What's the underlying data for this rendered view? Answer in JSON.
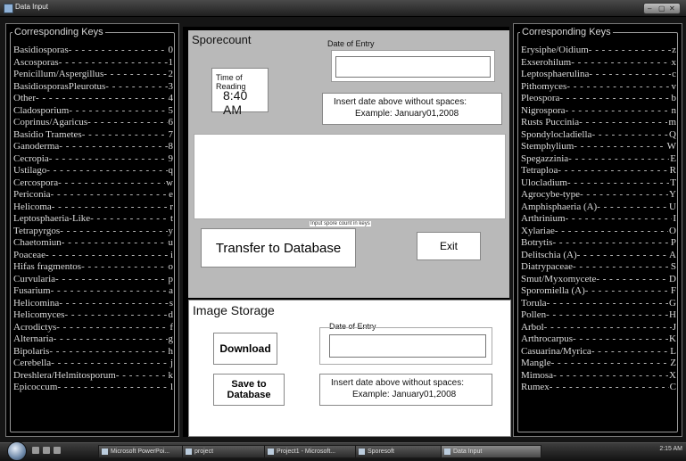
{
  "window": {
    "title": "Data Input",
    "controls": [
      "–",
      "▢",
      "✕"
    ]
  },
  "left_panel": {
    "legend": "Corresponding Keys",
    "items": [
      {
        "name": "Basidiosporas",
        "key": "0"
      },
      {
        "name": "Ascosporas",
        "key": "1"
      },
      {
        "name": "Penicillum/Aspergillus",
        "key": "2"
      },
      {
        "name": "BasidiosporasPleurotus",
        "key": "3"
      },
      {
        "name": "Other",
        "key": "4"
      },
      {
        "name": "Cladosporium",
        "key": "5"
      },
      {
        "name": "Coprinus/Agaricus",
        "key": "6"
      },
      {
        "name": "Basidio Trametes",
        "key": "7"
      },
      {
        "name": "Ganoderma",
        "key": "8"
      },
      {
        "name": "Cecropia",
        "key": "9"
      },
      {
        "name": "Ustilago",
        "key": "q"
      },
      {
        "name": "Cercospora",
        "key": "w"
      },
      {
        "name": "Periconia",
        "key": "e"
      },
      {
        "name": "Helicoma",
        "key": "r"
      },
      {
        "name": "Leptosphaeria-Like",
        "key": "t"
      },
      {
        "name": "Tetrapyrgos",
        "key": "y"
      },
      {
        "name": "Chaetomiun",
        "key": "u"
      },
      {
        "name": "Poaceae",
        "key": "i"
      },
      {
        "name": "Hifas fragmentos",
        "key": "o"
      },
      {
        "name": "Curvularia",
        "key": "p"
      },
      {
        "name": "Fusarium",
        "key": "a"
      },
      {
        "name": "Helicomina",
        "key": "s"
      },
      {
        "name": "Helicomyces",
        "key": "d"
      },
      {
        "name": "Acrodictys",
        "key": "f"
      },
      {
        "name": "Alternaria",
        "key": "g"
      },
      {
        "name": "Bipolaris",
        "key": "h"
      },
      {
        "name": "Cerebella",
        "key": "j"
      },
      {
        "name": "Dreshlera/Helmitosporum",
        "key": "k"
      },
      {
        "name": "Epicoccum",
        "key": "l"
      }
    ]
  },
  "right_panel": {
    "legend": "Corresponding Keys",
    "items": [
      {
        "name": "Erysiphe/Oidium",
        "key": "z"
      },
      {
        "name": "Exserohilum",
        "key": "x"
      },
      {
        "name": "Leptosphaerulina",
        "key": "c"
      },
      {
        "name": "Pithomyces",
        "key": "v"
      },
      {
        "name": "Pleospora",
        "key": "b"
      },
      {
        "name": "Nigrospora",
        "key": "n"
      },
      {
        "name": "Rusts Puccinia",
        "key": "m"
      },
      {
        "name": "Spondylocladiella",
        "key": "Q"
      },
      {
        "name": "Stemphylium",
        "key": "W"
      },
      {
        "name": "Spegazzinia",
        "key": "E"
      },
      {
        "name": "Tetraploa",
        "key": "R"
      },
      {
        "name": "Ulocladium",
        "key": "T"
      },
      {
        "name": "Agrocybe-type",
        "key": "Y"
      },
      {
        "name": "Amphisphaeria  (A)",
        "key": "U"
      },
      {
        "name": "Arthrinium",
        "key": "I"
      },
      {
        "name": "Xylariae",
        "key": "O"
      },
      {
        "name": "Botrytis",
        "key": "P"
      },
      {
        "name": "Delitschia (A)",
        "key": "A"
      },
      {
        "name": "Diatrypaceae",
        "key": "S"
      },
      {
        "name": "Smut/Myxomycete",
        "key": "D"
      },
      {
        "name": "Sporomiella (A)",
        "key": "F"
      },
      {
        "name": "Torula",
        "key": "G"
      },
      {
        "name": "Pollen",
        "key": "H"
      },
      {
        "name": "Arbol",
        "key": "J"
      },
      {
        "name": "Arthrocarpus",
        "key": "K"
      },
      {
        "name": "Casuarina/Myrica",
        "key": "L"
      },
      {
        "name": "Mangle",
        "key": "Z"
      },
      {
        "name": "Mimosa",
        "key": "X"
      },
      {
        "name": "Rumex",
        "key": "C"
      }
    ]
  },
  "sporecount": {
    "title": "Sporecount",
    "time_label": "Time of Reading",
    "time_value": "8:40 AM",
    "date_label": "Date of Entry",
    "date_value": "",
    "instructions": "Insert date above without spaces:",
    "example": "Example:  January01,2008",
    "count_hint": "Input spore count in keys",
    "transfer_label": "Transfer to Database",
    "exit_label": "Exit"
  },
  "image_storage": {
    "title": "Image Storage",
    "date_label": "Date of Entry",
    "date_value": "",
    "download_label": "Download",
    "save_label": "Save to Database",
    "instructions": "Insert date above without spaces:",
    "example": "Example:  January01,2008"
  },
  "taskbar": {
    "items": [
      "Microsoft PowerPoi...",
      "project",
      "Project1 - Microsoft...",
      "Sporesoft",
      "Data Input"
    ],
    "active": "Data Input",
    "clock": "2:15 AM"
  },
  "colors": {
    "form_gray": "#b9b9b9",
    "panel_black": "#000000",
    "key_text": "#dcdcdc"
  }
}
